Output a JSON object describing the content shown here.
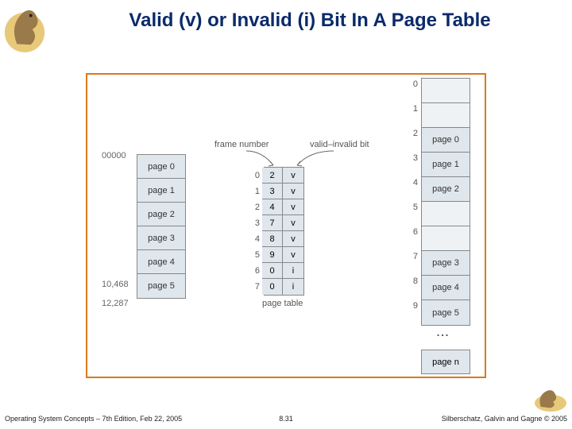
{
  "title": "Valid (v) or Invalid (i) Bit In A Page Table",
  "footer": {
    "left": "Operating System Concepts – 7th Edition, Feb 22, 2005",
    "center": "8.31",
    "right": "Silberschatz, Galvin and Gagne © 2005"
  },
  "labels": {
    "addr_start": "00000",
    "addr_10468": "10,468",
    "addr_12287": "12,287",
    "frame_number": "frame number",
    "valid_bit": "valid–invalid bit",
    "page_table_caption": "page table"
  },
  "logical_pages": [
    "page 0",
    "page 1",
    "page 2",
    "page 3",
    "page 4",
    "page 5"
  ],
  "page_table": [
    {
      "idx": "0",
      "frame": "2",
      "valid": "v"
    },
    {
      "idx": "1",
      "frame": "3",
      "valid": "v"
    },
    {
      "idx": "2",
      "frame": "4",
      "valid": "v"
    },
    {
      "idx": "3",
      "frame": "7",
      "valid": "v"
    },
    {
      "idx": "4",
      "frame": "8",
      "valid": "v"
    },
    {
      "idx": "5",
      "frame": "9",
      "valid": "v"
    },
    {
      "idx": "6",
      "frame": "0",
      "valid": "i"
    },
    {
      "idx": "7",
      "frame": "0",
      "valid": "i"
    }
  ],
  "physical_slots": [
    {
      "idx": "0",
      "label": ""
    },
    {
      "idx": "1",
      "label": ""
    },
    {
      "idx": "2",
      "label": "page 0"
    },
    {
      "idx": "3",
      "label": "page 1"
    },
    {
      "idx": "4",
      "label": "page 2"
    },
    {
      "idx": "5",
      "label": ""
    },
    {
      "idx": "6",
      "label": ""
    },
    {
      "idx": "7",
      "label": "page 3"
    },
    {
      "idx": "8",
      "label": "page 4"
    },
    {
      "idx": "9",
      "label": "page 5"
    }
  ],
  "physical_last": {
    "idx": "",
    "label": "page n"
  }
}
